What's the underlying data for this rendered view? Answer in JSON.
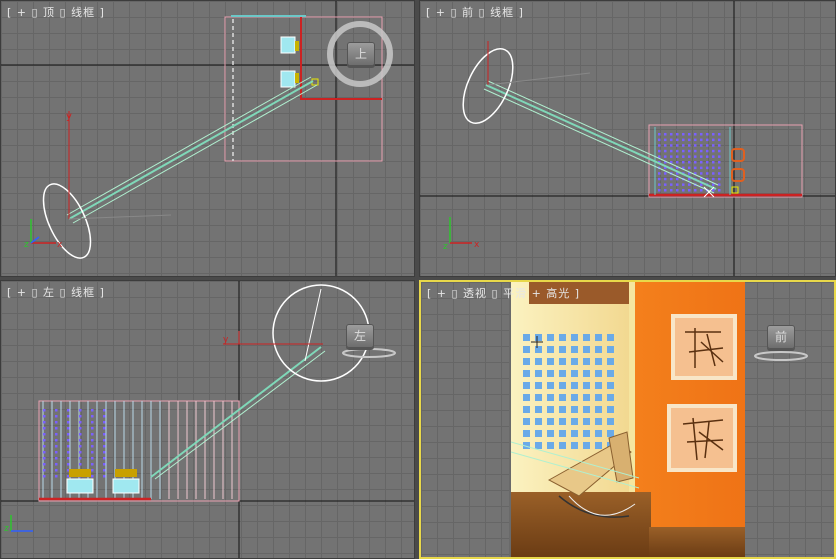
{
  "viewports": {
    "top": {
      "label": "[ + ▯ 顶 ▯ 线框 ]",
      "cube_label": "上"
    },
    "front": {
      "label": "[ + ▯ 前 ▯ 线框 ]"
    },
    "left": {
      "label": "[ + ▯ 左 ▯ 线框 ]",
      "cube_label": "左"
    },
    "perspective": {
      "label": "[ + ▯ 透视 ▯ 平滑 + 高光 ]",
      "cube_label": "前",
      "active": true
    }
  },
  "axes": {
    "x": "x",
    "y": "y",
    "z": "z"
  },
  "colors": {
    "grid_bg": "#737373",
    "grid_line": "#666666",
    "major_axis": "#000000",
    "active_border": "#e8d84a",
    "light_cone": "#7fd8b8",
    "room_outline": "#f0a0b0",
    "wall_orange": "#f07a1a",
    "wall_yellow": "#f5e6a0"
  }
}
